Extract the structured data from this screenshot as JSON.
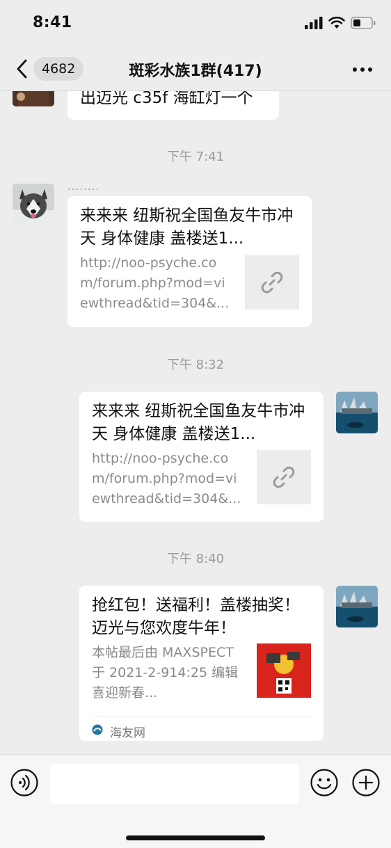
{
  "status_bar": {
    "time": "8:41",
    "signal_icon": "cellular-signal-icon",
    "wifi_icon": "wifi-icon",
    "battery_icon": "battery-icon"
  },
  "nav": {
    "back_icon": "chevron-left-icon",
    "unread_count": "4682",
    "title": "斑彩水族1群(417)",
    "more_icon": "more-dots-icon"
  },
  "messages": [
    {
      "type": "text",
      "side": "left",
      "text": "出迈光 c35f 海缸灯一个"
    },
    {
      "type": "time",
      "text": "下午 7:41"
    },
    {
      "type": "link",
      "side": "left",
      "sender": "........",
      "title": "来来来 纽斯祝全国鱼友牛市冲天 身体健康 盖楼送1...",
      "desc": "http://noo-psyche.com/forum.php?mod=viewthread&tid=304&...",
      "thumb_icon": "link-icon"
    },
    {
      "type": "time",
      "text": "下午 8:32"
    },
    {
      "type": "link",
      "side": "right",
      "title": "来来来 纽斯祝全国鱼友牛市冲天 身体健康 盖楼送1...",
      "desc": "http://noo-psyche.com/forum.php?mod=viewthread&tid=304&...",
      "thumb_icon": "link-icon"
    },
    {
      "type": "time",
      "text": "下午 8:40"
    },
    {
      "type": "article",
      "side": "right",
      "title": "抢红包！送福利！盖楼抽奖！迈光与您欢度牛年！",
      "desc": "本帖最后由 MAXSPECT 于 2021-2-914:25 编辑喜迎新春...",
      "source": "海友网",
      "source_icon": "site-logo-icon"
    }
  ],
  "input_bar": {
    "voice_icon": "voice-icon",
    "message_value": "",
    "emoji_icon": "emoji-icon",
    "plus_icon": "plus-circle-icon"
  }
}
